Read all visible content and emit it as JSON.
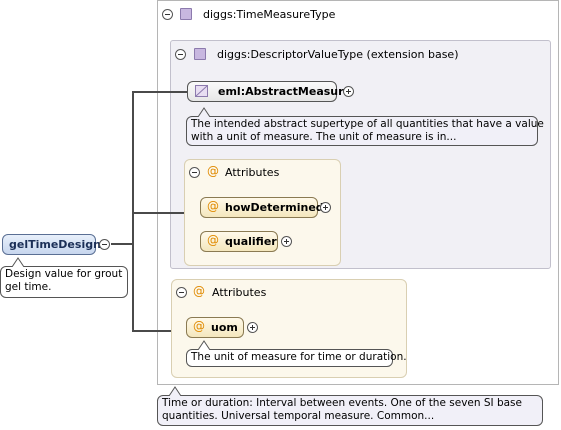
{
  "root_element": {
    "name": "gelTimeDesign",
    "doc": [
      "Design value for grout",
      "gel time."
    ]
  },
  "type": {
    "name": "diggs:TimeMeasureType",
    "doc": [
      "Time or duration: Interval between events. One of the seven SI base",
      "quantities. Universal temporal measure. Common..."
    ]
  },
  "extension": {
    "name": "diggs:DescriptorValueType (extension base)"
  },
  "abstract_measure": {
    "name": "eml:AbstractMeasure",
    "doc": [
      "The intended abstract supertype of all quantities that have a value",
      "with a unit of measure. The unit of measure is in..."
    ]
  },
  "attributes_1": {
    "label": "Attributes",
    "items": [
      "howDetermined",
      "qualifier"
    ]
  },
  "attributes_2": {
    "label": "Attributes",
    "items": [
      "uom"
    ],
    "uom_doc": "The unit of measure for time or duration."
  },
  "icons": {
    "collapse": "minus-circle-icon",
    "expand": "plus-circle-icon",
    "complex_type": "complex-type-square-icon",
    "attribute": "at-sign-icon",
    "abstract": "abstract-diagonal-icon"
  }
}
